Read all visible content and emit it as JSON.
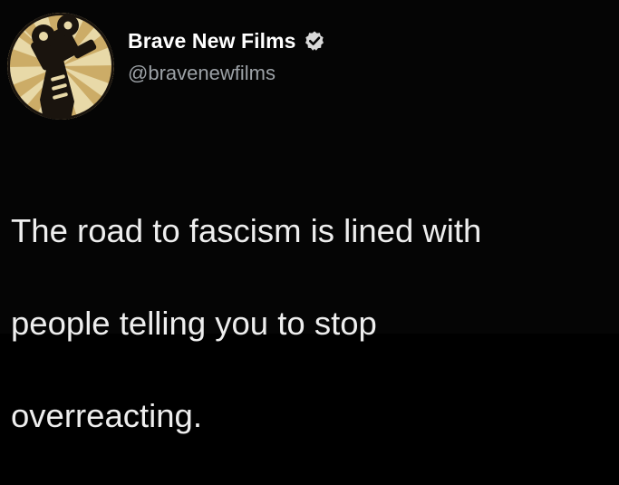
{
  "tweet": {
    "author": {
      "display_name": "Brave New Films",
      "handle": "@bravenewfilms",
      "verified": true,
      "avatar_icon": "film-camera-hand-icon"
    },
    "text_lines": [
      "The road to fascism is lined with",
      "people telling you to stop",
      "overreacting."
    ]
  },
  "colors": {
    "background": "#000000",
    "name": "#ffffff",
    "handle": "#9ca1a6",
    "body_text": "#eeeeee",
    "avatar_cream": "#e8d9a8",
    "avatar_ray": "#c7a45c",
    "avatar_ink": "#1a140e"
  }
}
